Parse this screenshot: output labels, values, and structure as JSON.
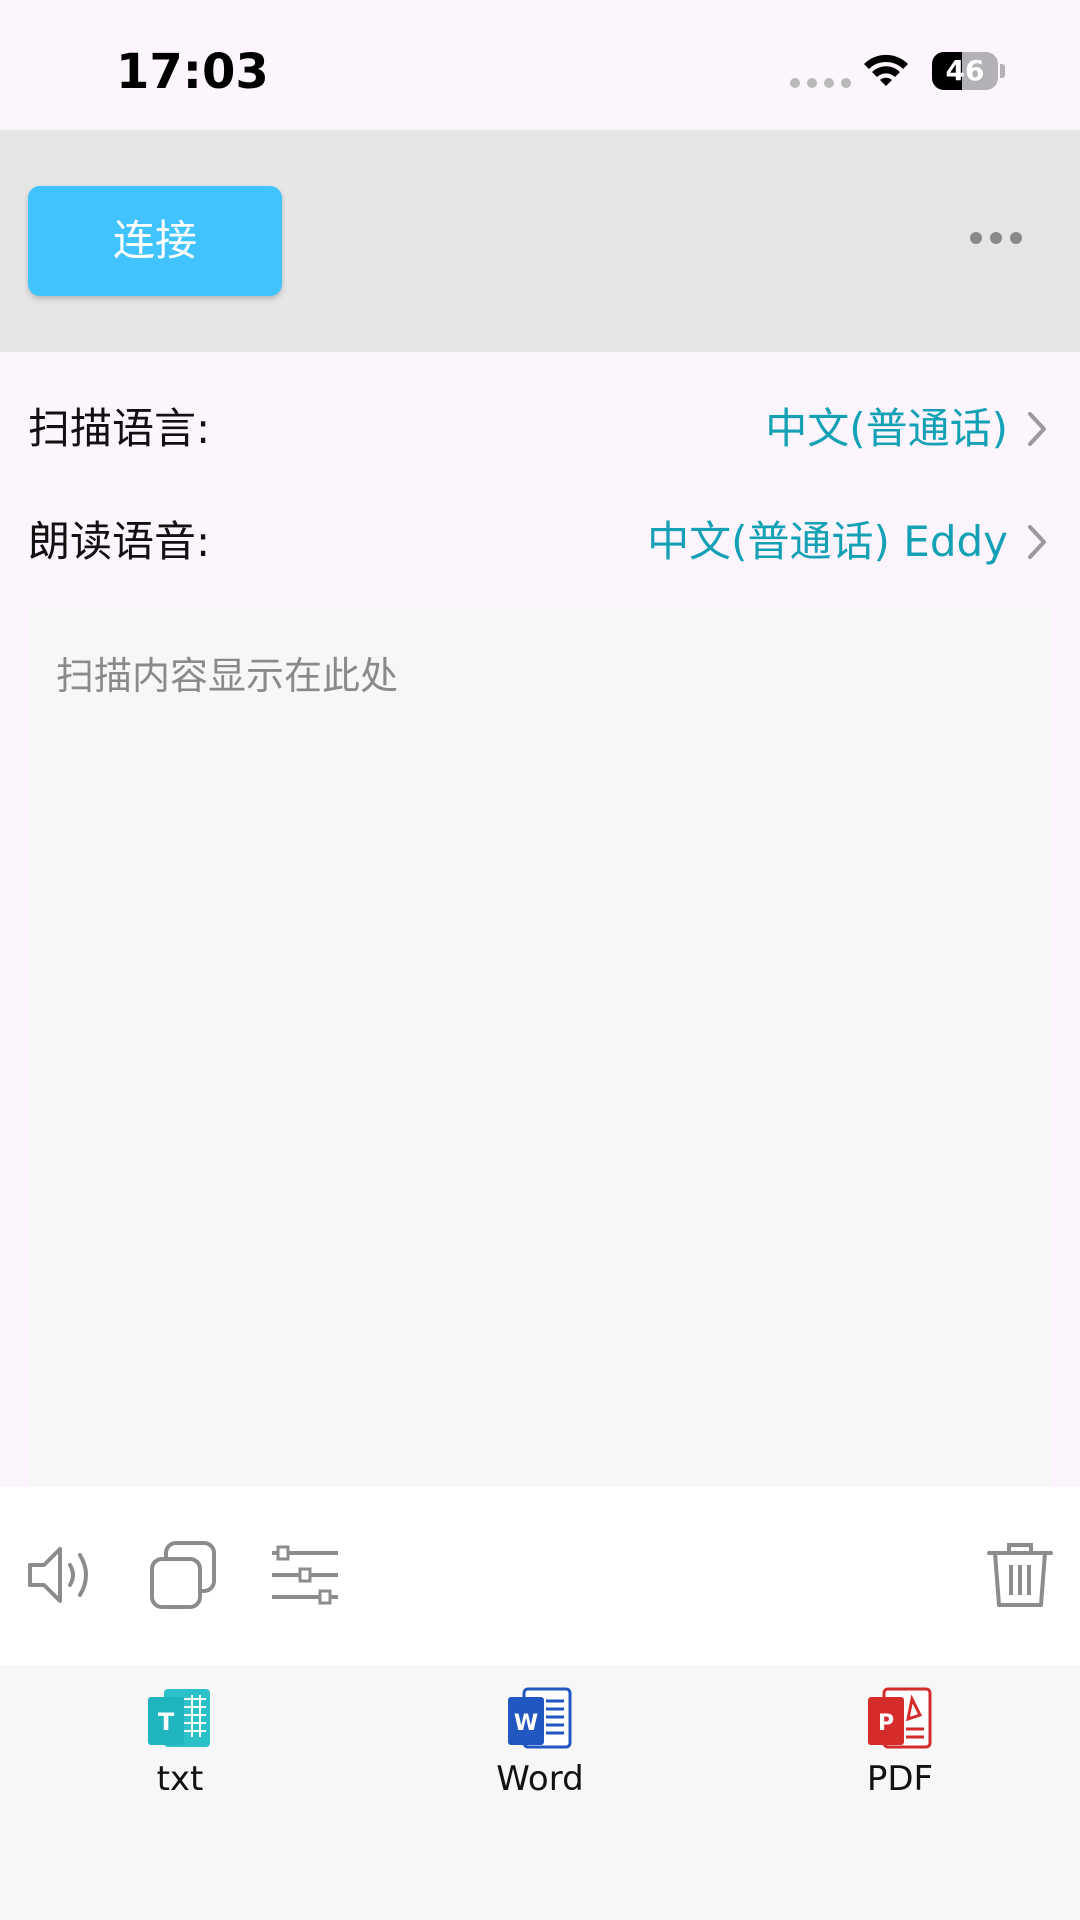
{
  "status": {
    "time": "17:03",
    "battery": "46",
    "battery_level_percent": 46
  },
  "toolbar": {
    "connect_label": "连接",
    "more_icon": "ellipsis-icon"
  },
  "settings": {
    "scan_language": {
      "label": "扫描语言:",
      "value": "中文(普通话)"
    },
    "read_voice": {
      "label": "朗读语音:",
      "value": "中文(普通话) Eddy"
    }
  },
  "scan": {
    "placeholder": "扫描内容显示在此处"
  },
  "actions": {
    "icons": [
      "speaker-icon",
      "copy-icon",
      "sliders-icon",
      "trash-icon"
    ]
  },
  "exports": [
    {
      "label": "txt",
      "icon": "txt-file-icon",
      "color": "#1fb5bf"
    },
    {
      "label": "Word",
      "icon": "word-file-icon",
      "color": "#2057c0"
    },
    {
      "label": "PDF",
      "icon": "pdf-file-icon",
      "color": "#d42b2b"
    }
  ],
  "colors": {
    "accent": "#40c3ff",
    "link": "#14a1b5",
    "background": "#fdf5fd"
  }
}
